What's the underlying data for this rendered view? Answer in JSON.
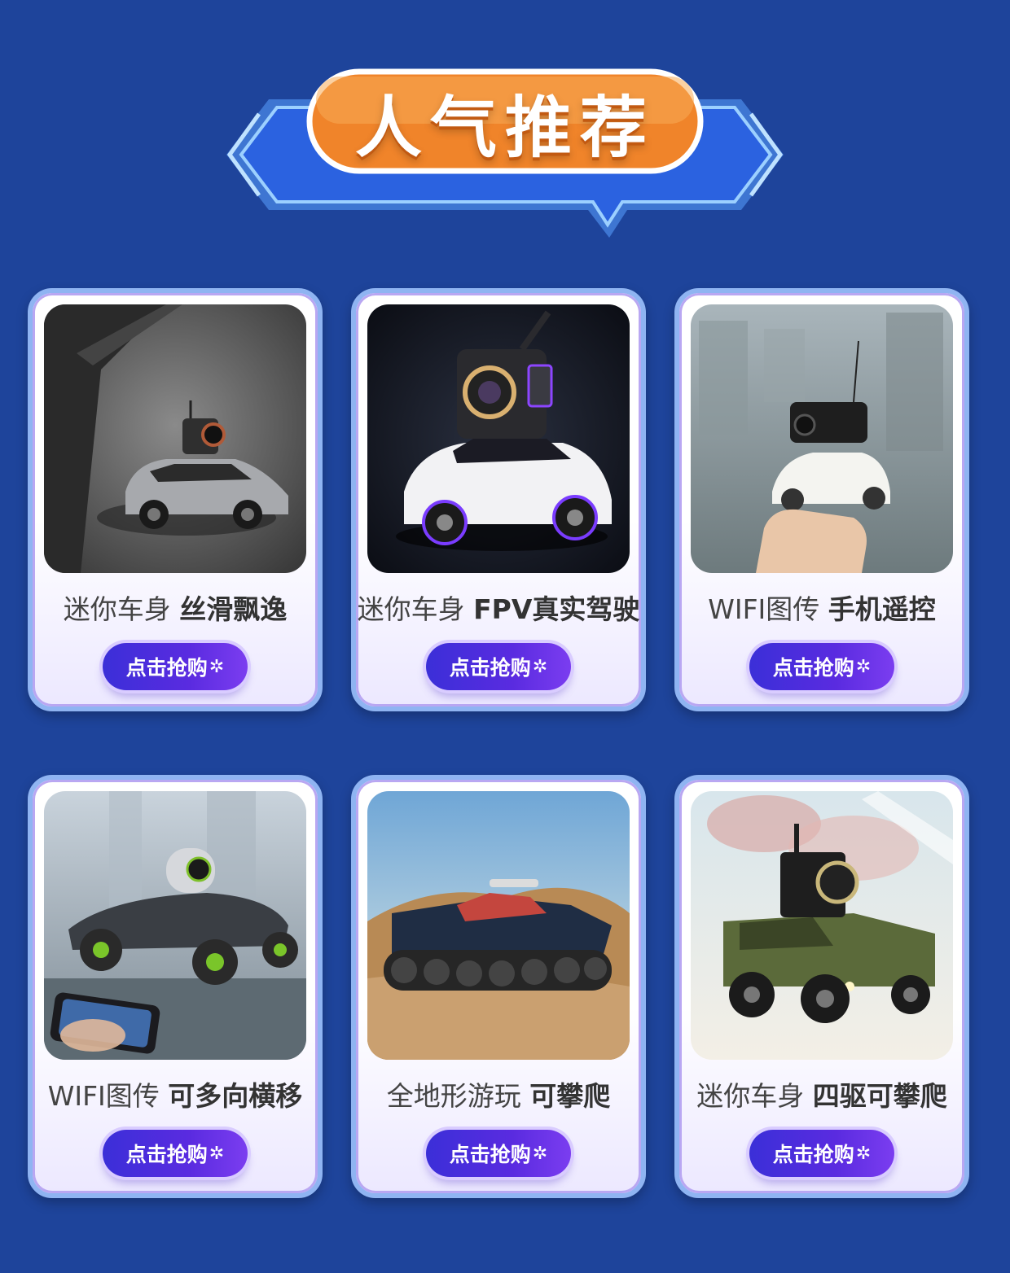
{
  "header": {
    "title": "人气推荐"
  },
  "products": [
    {
      "caption_main": "迷你车身 ",
      "caption_strong": "丝滑飘逸",
      "button_label": "点击抢购",
      "button_icon": "sparkle-icon"
    },
    {
      "caption_main": "迷你车身 ",
      "caption_strong": "FPV真实驾驶",
      "button_label": "点击抢购",
      "button_icon": "sparkle-icon"
    },
    {
      "caption_main": "WIFI图传 ",
      "caption_strong": "手机遥控",
      "button_label": "点击抢购",
      "button_icon": "sparkle-icon"
    },
    {
      "caption_main": "WIFI图传 ",
      "caption_strong": "可多向横移",
      "button_label": "点击抢购",
      "button_icon": "sparkle-icon"
    },
    {
      "caption_main": "全地形游玩 ",
      "caption_strong": "可攀爬",
      "button_label": "点击抢购",
      "button_icon": "sparkle-icon"
    },
    {
      "caption_main": "迷你车身 ",
      "caption_strong": "四驱可攀爬",
      "button_label": "点击抢购",
      "button_icon": "sparkle-icon"
    }
  ],
  "colors": {
    "background": "#1e449b",
    "title_pill": "#f59a34",
    "button": "#4a2fdc"
  }
}
